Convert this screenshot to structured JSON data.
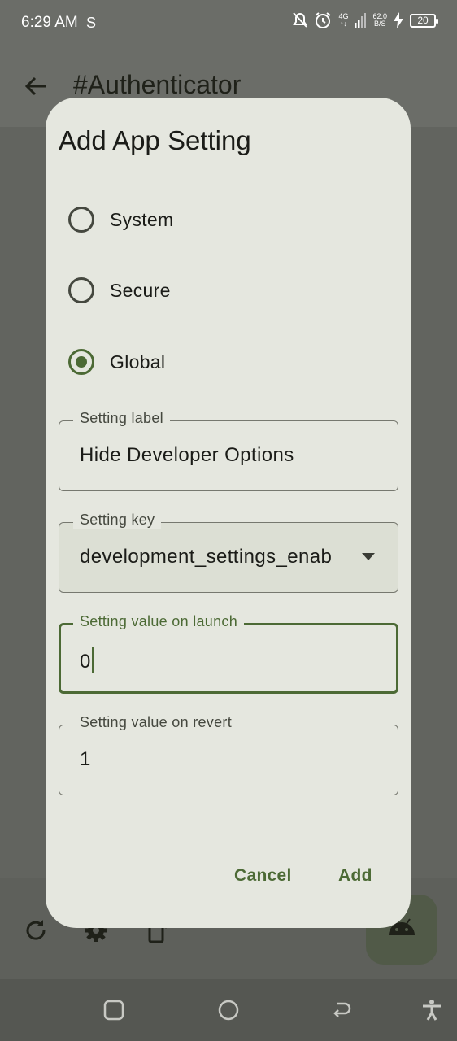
{
  "status_bar": {
    "time": "6:29 AM",
    "sim_indicator": "S",
    "network": "4G",
    "speed_value": "62.0",
    "speed_unit": "B/S",
    "battery": "20"
  },
  "app_bar": {
    "title": "#Authenticator"
  },
  "dialog": {
    "title": "Add App Setting",
    "radio_options": [
      {
        "label": "System",
        "selected": false
      },
      {
        "label": "Secure",
        "selected": false
      },
      {
        "label": "Global",
        "selected": true
      }
    ],
    "fields": {
      "setting_label": {
        "label": "Setting label",
        "value": "Hide Developer Options"
      },
      "setting_key": {
        "label": "Setting key",
        "value": "development_settings_enabled"
      },
      "value_on_launch": {
        "label": "Setting value on launch",
        "value": "0"
      },
      "value_on_revert": {
        "label": "Setting value on revert",
        "value": "1"
      }
    },
    "buttons": {
      "cancel": "Cancel",
      "add": "Add"
    }
  },
  "colors": {
    "accent": "#4c6a35",
    "dialog_bg": "#e5e7df",
    "scrim": "#5f615c"
  },
  "icons": [
    "back-arrow-icon",
    "refresh-icon",
    "settings-icon",
    "phone-sparkle-icon",
    "android-icon",
    "recents-icon",
    "home-icon",
    "back-nav-icon",
    "accessibility-icon"
  ]
}
